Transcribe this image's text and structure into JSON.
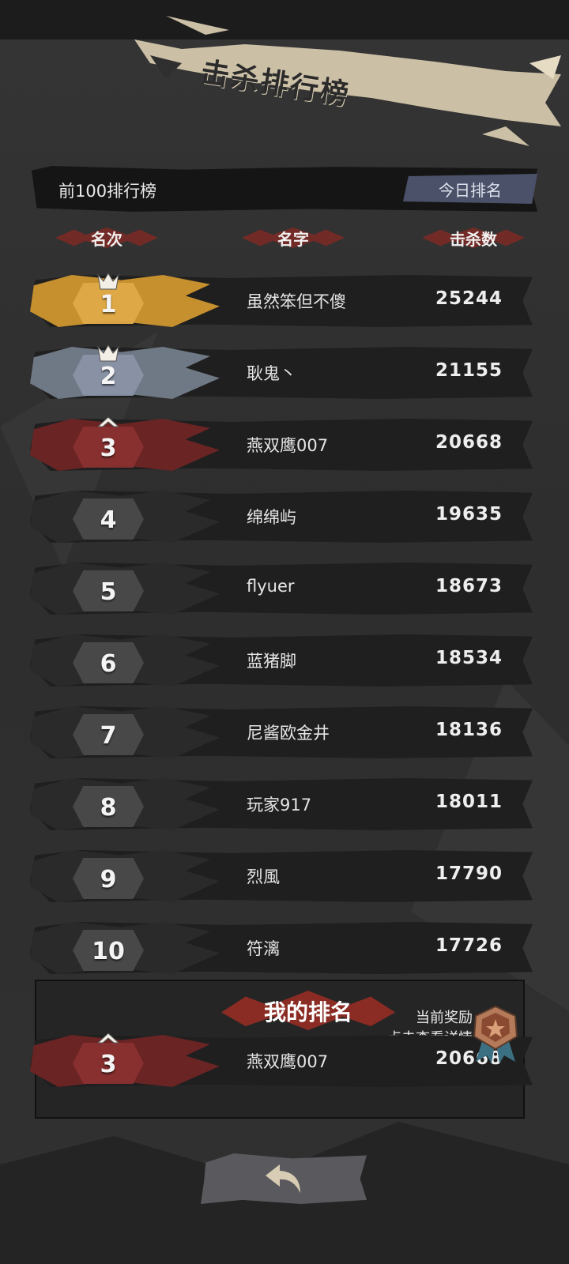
{
  "header": {
    "title": "击杀排行榜",
    "list_label": "前100排行榜",
    "today_button": "今日排名"
  },
  "columns": {
    "rank": "名次",
    "name": "名字",
    "kills": "击杀数"
  },
  "leaderboard": [
    {
      "rank": "1",
      "name": "虽然笨但不傻",
      "kills": "25244",
      "tier": "gold"
    },
    {
      "rank": "2",
      "name": "耿鬼丶",
      "kills": "21155",
      "tier": "silver"
    },
    {
      "rank": "3",
      "name": "燕双鹰007",
      "kills": "20668",
      "tier": "bronze"
    },
    {
      "rank": "4",
      "name": "绵绵屿",
      "kills": "19635",
      "tier": "normal"
    },
    {
      "rank": "5",
      "name": "flyuer",
      "kills": "18673",
      "tier": "normal"
    },
    {
      "rank": "6",
      "name": "蓝猪脚",
      "kills": "18534",
      "tier": "normal"
    },
    {
      "rank": "7",
      "name": "尼酱欧金井",
      "kills": "18136",
      "tier": "normal"
    },
    {
      "rank": "8",
      "name": "玩家917",
      "kills": "18011",
      "tier": "normal"
    },
    {
      "rank": "9",
      "name": "烈風",
      "kills": "17790",
      "tier": "normal"
    },
    {
      "rank": "10",
      "name": "符漓",
      "kills": "17726",
      "tier": "normal"
    }
  ],
  "my_rank": {
    "title": "我的排名",
    "reward_line1": "当前奖励",
    "reward_line2": "点击查看详情",
    "rank": "3",
    "name": "燕双鹰007",
    "kills": "20668",
    "tier": "bronze"
  },
  "tier_colors": {
    "gold": {
      "splash": "#c6902e",
      "badge": "#e0aa48"
    },
    "silver": {
      "splash": "#6f7885",
      "badge": "#8a94a6"
    },
    "bronze": {
      "splash": "#6a2424",
      "badge": "#8a3030"
    },
    "normal": {
      "splash": "#2a2a2a",
      "badge": "#4a4a4a"
    }
  },
  "icons": {
    "crown": "crown-icon",
    "medal": "medal-icon",
    "back": "back-arrow-icon"
  }
}
